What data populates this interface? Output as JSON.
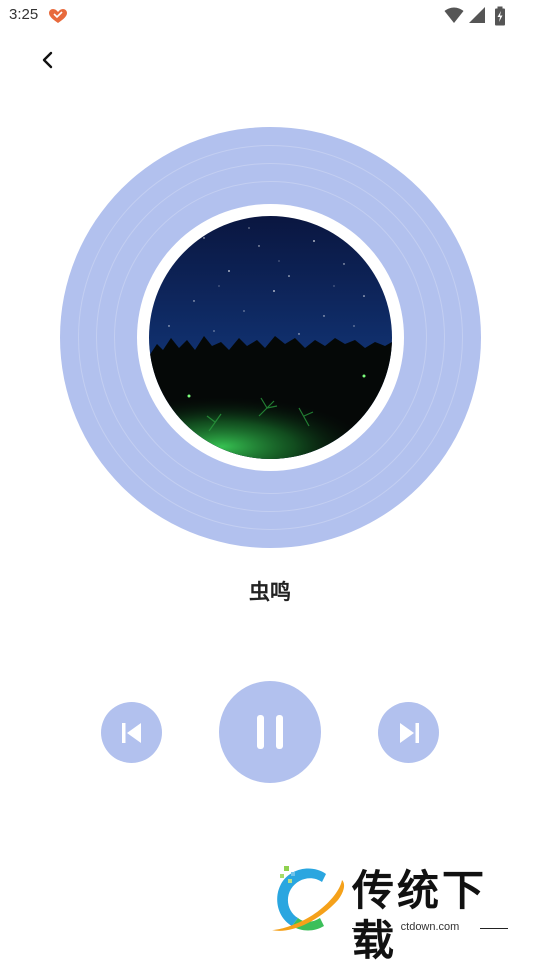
{
  "status_bar": {
    "time": "3:25",
    "icons": [
      "app-notification-icon",
      "wifi-icon",
      "cellular-signal-icon",
      "battery-charging-icon"
    ]
  },
  "header": {
    "back_icon": "chevron-left-icon"
  },
  "player": {
    "song_title": "虫鸣",
    "album_art": "night-sky-forest-fireflies",
    "disc_color": "#b2c1ee",
    "controls": {
      "previous_icon": "skip-previous-icon",
      "play_pause_icon": "pause-icon",
      "next_icon": "skip-next-icon"
    }
  },
  "watermark": {
    "name": "传统下载",
    "url": "ctdown.com"
  }
}
